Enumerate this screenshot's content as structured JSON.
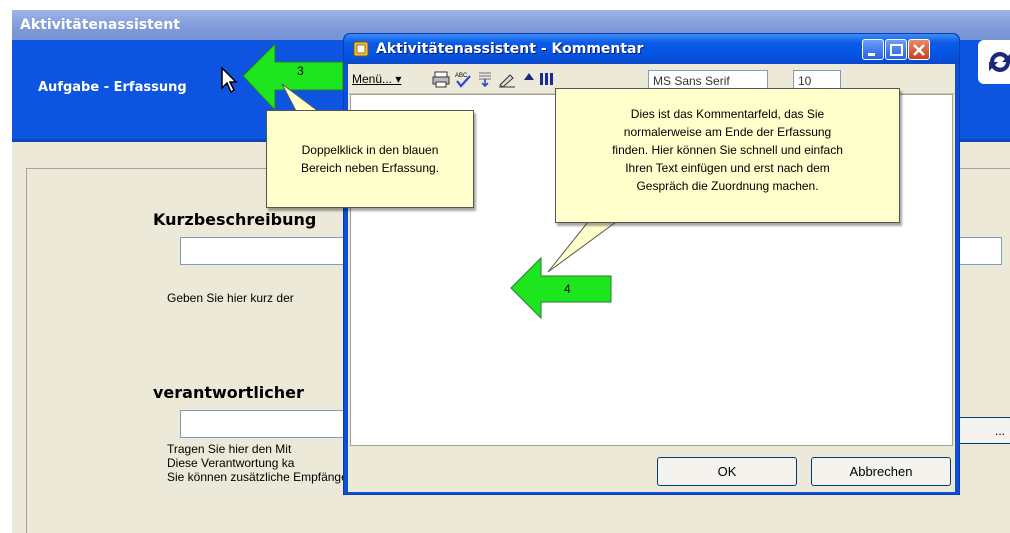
{
  "background_window": {
    "title": "Aktivitätenassistent",
    "header_title": "Aufgabe - Erfassung",
    "section1_label": "Kurzbeschreibung",
    "section1_help": "Geben Sie hier kurz der",
    "section2_label": "verantwortlicher",
    "section2_help_lines": [
      "Tragen Sie hier den Mit",
      "Diese Verantwortung ka",
      "Sie können zusätzliche Empfänger als CC-Empfänger zuordnen."
    ],
    "browse_button_label": "..."
  },
  "dialog": {
    "title": "Aktivitätenassistent - Kommentar",
    "menu_label": "Menü...",
    "font_value": "MS Sans Serif",
    "size_value": "10",
    "ok_label": "OK",
    "cancel_label": "Abbrechen"
  },
  "callouts": {
    "step3": {
      "number": "3",
      "text_lines": [
        "Doppelklick in den blauen",
        "Bereich neben Erfassung."
      ]
    },
    "step4": {
      "number": "4",
      "text_lines": [
        "Dies ist das Kommentarfeld, das Sie",
        "normalerweise am Ende der Erfassung",
        "finden. Hier können Sie schnell und einfach",
        "Ihren Text einfügen und erst nach dem",
        "Gespräch die Zuordnung machen."
      ]
    }
  },
  "colors": {
    "xp_blue": "#0d54e0",
    "callout_fill": "#ffffcc",
    "arrow_green": "#1ee61e"
  },
  "icons": [
    "cursor-icon",
    "sync-icon",
    "app-icon",
    "minimize-icon",
    "maximize-icon",
    "close-icon",
    "printer-icon",
    "spellcheck-icon",
    "insert-icon",
    "pen-icon",
    "bold-icon",
    "columns-icon",
    "arrow-right-icon",
    "arrow-left-icon"
  ]
}
